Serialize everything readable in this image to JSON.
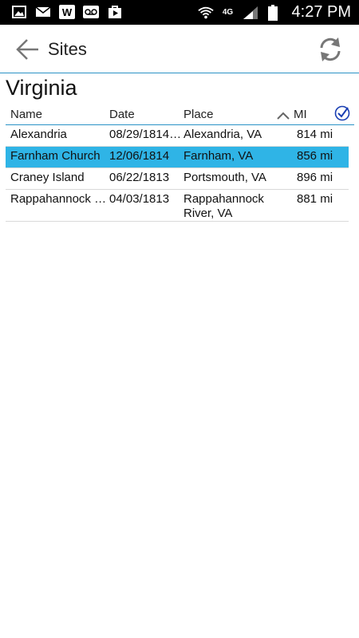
{
  "status_bar": {
    "time": "4:27 PM",
    "network": "4G"
  },
  "toolbar": {
    "title": "Sites",
    "back_icon": "arrow-left-icon",
    "refresh_icon": "refresh-icon"
  },
  "region": {
    "title": "Virginia"
  },
  "columns": {
    "name": "Name",
    "date": "Date",
    "place": "Place",
    "mi": "MI"
  },
  "rows": [
    {
      "name": "Alexandria",
      "date": "08/29/1814…",
      "place": "Alexandria, VA",
      "mi": "814 mi"
    },
    {
      "name": "Farnham Church",
      "date": "12/06/1814",
      "place": "Farnham, VA",
      "mi": "856 mi",
      "selected": true
    },
    {
      "name": "Craney Island",
      "date": "06/22/1813",
      "place": "Portsmouth, VA",
      "mi": "896 mi"
    },
    {
      "name": "Rappahannock R…",
      "date": "04/03/1813",
      "place": "Rappahannock River, VA",
      "mi": "881 mi"
    }
  ],
  "colors": {
    "accent": "#2a92c6",
    "selected_row": "#2fb4e6",
    "check_icon": "#1a3fb3"
  }
}
